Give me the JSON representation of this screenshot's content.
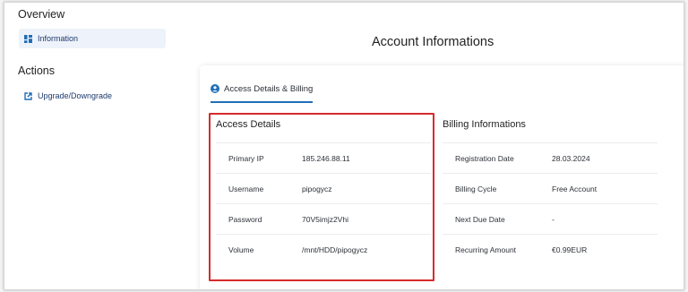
{
  "sidebar": {
    "overview_title": "Overview",
    "overview_items": [
      {
        "label": "Information",
        "icon": "grid-icon",
        "active": true
      }
    ],
    "actions_title": "Actions",
    "actions_items": [
      {
        "label": "Upgrade/Downgrade",
        "icon": "external-link-icon"
      }
    ]
  },
  "main": {
    "title": "Account Informations",
    "tab": {
      "label": "Access Details & Billing",
      "icon": "user-circle-icon"
    },
    "access_details": {
      "title": "Access Details",
      "rows": [
        {
          "label": "Primary IP",
          "value": "185.246.88.11"
        },
        {
          "label": "Username",
          "value": "pipogycz"
        },
        {
          "label": "Password",
          "value": "70V5imjz2Vhi"
        },
        {
          "label": "Volume",
          "value": "/mnt/HDD/pipogycz"
        }
      ]
    },
    "billing": {
      "title": "Billing Informations",
      "rows": [
        {
          "label": "Registration Date",
          "value": "28.03.2024"
        },
        {
          "label": "Billing Cycle",
          "value": "Free Account"
        },
        {
          "label": "Next Due Date",
          "value": "-"
        },
        {
          "label": "Recurring Amount",
          "value": "€0.99EUR"
        }
      ]
    }
  },
  "colors": {
    "accent": "#1f6fb8",
    "highlight_border": "#d62b2b",
    "nav_active_bg": "#eef2fa",
    "nav_text": "#1e3a6e"
  }
}
